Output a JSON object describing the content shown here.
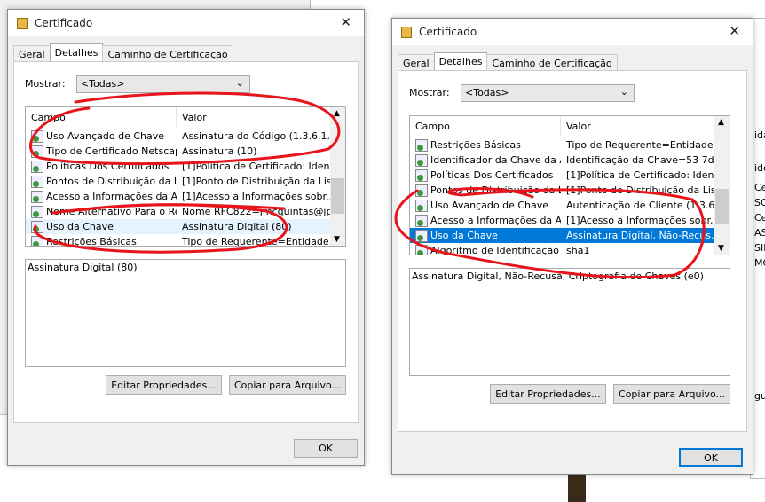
{
  "background": {
    "right_snippets": [
      "idad",
      "ido",
      "Cert",
      "SOLU",
      "Cert",
      "ASA",
      "SINC",
      "MOD",
      "gur"
    ]
  },
  "left": {
    "title": "Certificado",
    "close": "✕",
    "tabs": [
      "Geral",
      "Detalhes",
      "Caminho de Certificação"
    ],
    "show_label": "Mostrar:",
    "show_value": "<Todas>",
    "chev": "⌄",
    "col_field": "Campo",
    "col_value": "Valor",
    "rows": [
      [
        "Uso Avançado de Chave",
        "Assinatura do Código (1.3.6.1..."
      ],
      [
        "Tipo de Certificado Netscape",
        "Assinatura (10)"
      ],
      [
        "Políticas Dos Certificados",
        "[1]Política de Certificado: Iden..."
      ],
      [
        "Pontos de Distribuição da Li...",
        "[1]Ponto de Distribuição da Lis..."
      ],
      [
        "Acesso a Informações da A...",
        "[1]Acesso a Informações sobr..."
      ],
      [
        "Nome Alternativo Para o Re...",
        "Nome RFC822=jmcquintas@jp..."
      ],
      [
        "Uso da Chave",
        "Assinatura Digital (80)"
      ],
      [
        "Restrições Básicas",
        "Tipo de Requerente=Entidade..."
      ]
    ],
    "detail": "Assinatura Digital (80)",
    "edit": "Editar Propriedades...",
    "copy": "Copiar para Arquivo...",
    "ok": "OK"
  },
  "right": {
    "title": "Certificado",
    "close": "✕",
    "tabs": [
      "Geral",
      "Detalhes",
      "Caminho de Certificação"
    ],
    "show_label": "Mostrar:",
    "show_value": "<Todas>",
    "chev": "⌄",
    "col_field": "Campo",
    "col_value": "Valor",
    "rows": [
      [
        "Restrições Básicas",
        "Tipo de Requerente=Entidade..."
      ],
      [
        "Identificador da Chave da A...",
        "Identificação da Chave=53 7d..."
      ],
      [
        "Políticas Dos Certificados",
        "[1]Política de Certificado: Iden..."
      ],
      [
        "Pontos de Distribuição da Li...",
        "[1]Ponto de Distribuição da Lis..."
      ],
      [
        "Uso Avançado de Chave",
        "Autenticação de Cliente (1.3.6..."
      ],
      [
        "Acesso a Informações da A...",
        "[1]Acesso a Informações sobr..."
      ],
      [
        "Uso da Chave",
        "Assinatura Digital, Não-Recus..."
      ],
      [
        "Algoritmo de Identificação",
        "sha1"
      ]
    ],
    "detail": "Assinatura Digital, Não-Recusa, Criptografia de Chaves (e0)",
    "edit": "Editar Propriedades...",
    "copy": "Copiar para Arquivo...",
    "ok": "OK"
  },
  "colors": {
    "selection": "#0078d7",
    "annotation": "#e8141c"
  }
}
